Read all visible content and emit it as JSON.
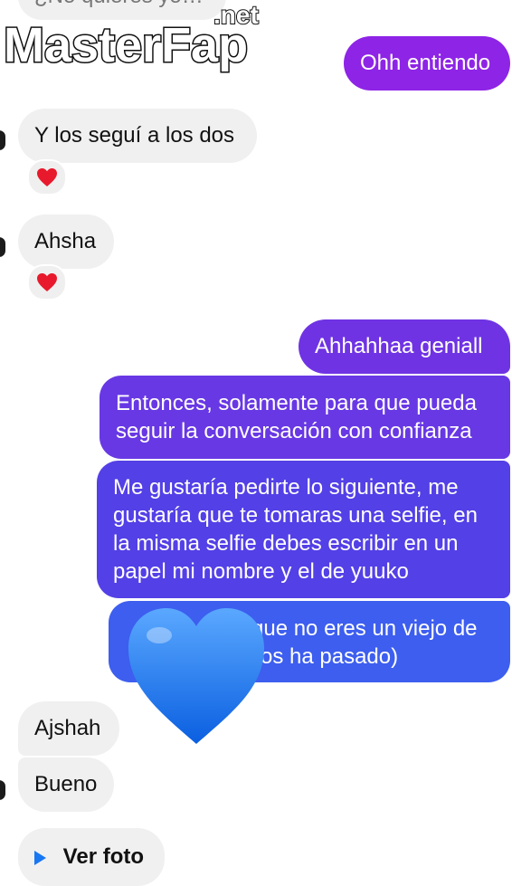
{
  "watermark": {
    "brand": "MasterFap",
    "domain": ".net"
  },
  "messages": {
    "top_partial": "¿No quieres yo…",
    "m1": "Ohh entiendo",
    "m2": "Y los seguí a los dos",
    "m3": "Ahsha",
    "m4": "Ahhahhaa geniall",
    "m5_l1": "Entonces, solamente para que pueda",
    "m5_l2": "seguir la conversación con confianza",
    "m6_l1": "Me gustaría pedirte lo siguiente, me",
    "m6_l2": "gustaría que te tomaras una selfie, en",
    "m6_l3": "la misma selfie debes escribir en un",
    "m6_l4": "papel mi nombre y el de yuuko",
    "m7_l1": "que no eres un viejo de",
    "m7_l2": "os ha pasado)",
    "m8": "Ajshah",
    "m9": "Bueno",
    "ver_foto": "Ver foto"
  },
  "reactions": {
    "r1": "heart-emoji",
    "r2": "heart-emoji"
  },
  "overlay": {
    "icon": "blue-heart-emoji"
  },
  "colors": {
    "incoming_bg": "#f0f0f0",
    "outgoing_top": "#8a2be2",
    "outgoing_bottom": "#3b5ef0",
    "heart_red": "#e8192c",
    "blue_heart": "#1f7af0"
  }
}
